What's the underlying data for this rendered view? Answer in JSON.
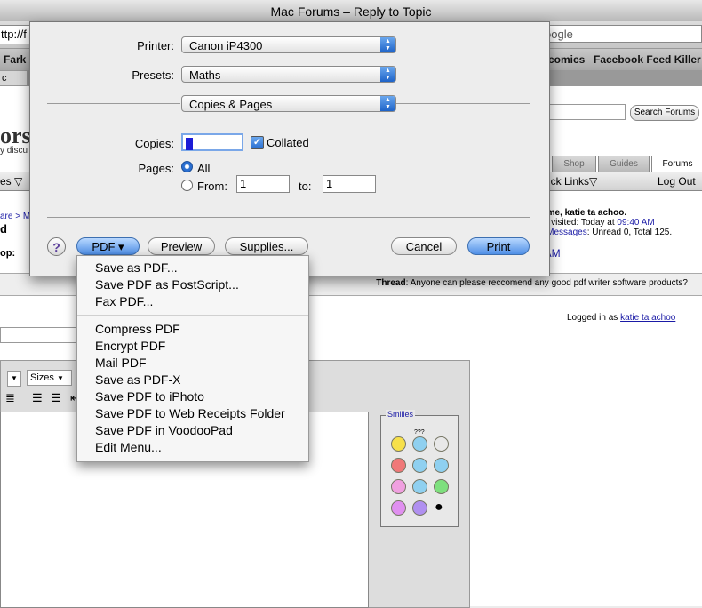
{
  "window": {
    "title": "Mac Forums – Reply to Topic"
  },
  "browser": {
    "url_fragment": "ttp://f",
    "search_placeholder": "oogle",
    "bookmarks": [
      "Fark",
      "comics",
      "Facebook Feed Killer"
    ],
    "tab_fragment": "c"
  },
  "page": {
    "search_button": "Search Forums",
    "logo": "ors",
    "logo_sub": "y discu",
    "tabs": [
      "Shop",
      "Guides",
      "Forums"
    ],
    "nav_left": "es",
    "nav_quick_links": "ick Links",
    "nav_logout": "Log Out",
    "crumb": "are > M",
    "crumb_d": "d",
    "jump": "op:",
    "welcome": "come, katie ta achoo.",
    "last_visited_prefix": "ast visited: Today at ",
    "last_visited_time": "09:40 AM",
    "private_messages_link": "te Messages",
    "messages_stats": ": Unread 0, Total 125.",
    "ram": "RAM",
    "thread_label": "Thread",
    "thread_title": ": Anyone can please reccomend any good pdf writer software products?",
    "logged_in_prefix": "Logged in as ",
    "logged_in_user": "katie ta achoo",
    "sizes": "Sizes",
    "smilies": "Smilies",
    "smilie_top": "???"
  },
  "dialog": {
    "printer_label": "Printer:",
    "printer_value": "Canon iP4300",
    "presets_label": "Presets:",
    "presets_value": "Maths",
    "panel_value": "Copies & Pages",
    "copies_label": "Copies:",
    "copies_value": "1",
    "collated_label": "Collated",
    "collated_checked": true,
    "pages_label": "Pages:",
    "pages_all": "All",
    "pages_from": "From:",
    "from_value": "1",
    "pages_to": "to:",
    "to_value": "1",
    "help": "?",
    "pdf_button": "PDF ▾",
    "preview_button": "Preview",
    "supplies_button": "Supplies...",
    "cancel_button": "Cancel",
    "print_button": "Print"
  },
  "pdf_menu": {
    "group1": [
      "Save as PDF...",
      "Save PDF as PostScript...",
      "Fax PDF..."
    ],
    "group2": [
      "Compress PDF",
      "Encrypt PDF",
      "Mail PDF",
      "Save as PDF-X",
      "Save PDF to iPhoto",
      "Save PDF to Web Receipts Folder",
      "Save PDF in VoodooPad",
      "Edit Menu..."
    ]
  },
  "colors": {
    "accent": "#2a6fd1",
    "link": "#1a1aa6"
  }
}
